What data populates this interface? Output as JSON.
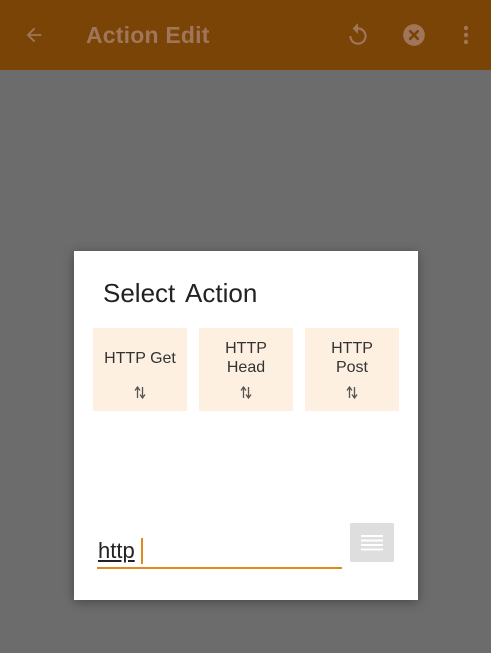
{
  "appbar": {
    "title": "Action Edit",
    "icons": [
      "back-arrow-icon",
      "undo-icon",
      "cancel-circle-icon",
      "more-vert-icon"
    ]
  },
  "dialog": {
    "title": "Select  Action",
    "actions": [
      {
        "label_lines": [
          "HTTP Get"
        ]
      },
      {
        "label_lines": [
          "HTTP",
          "Head"
        ]
      },
      {
        "label_lines": [
          "HTTP",
          "Post"
        ]
      }
    ],
    "search": {
      "value": "http"
    }
  },
  "colors": {
    "accent": "#e08a1e",
    "tile_bg": "#fdf0e0",
    "overlay_bg": "#6c6c6c",
    "appbar_bg": "#7a4406"
  }
}
